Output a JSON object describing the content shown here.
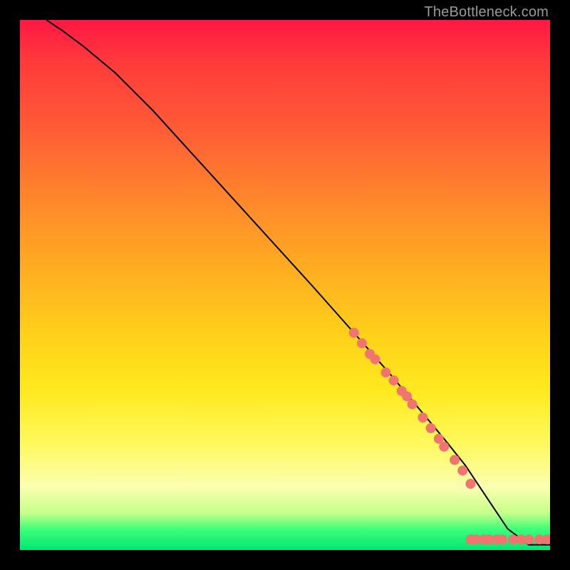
{
  "watermark": "TheBottleneck.com",
  "colors": {
    "dot_fill": "#f07470",
    "curve_stroke": "#000000",
    "background_black": "#000000",
    "gradient_top": "#ff1744",
    "gradient_bottom": "#00e676"
  },
  "chart_data": {
    "type": "line",
    "title": "",
    "xlabel": "",
    "ylabel": "",
    "xlim": [
      0,
      100
    ],
    "ylim": [
      0,
      100
    ],
    "curve": {
      "x": [
        5,
        8,
        12,
        18,
        25,
        35,
        45,
        55,
        63,
        70,
        75,
        80,
        84,
        88,
        92,
        96,
        100
      ],
      "y": [
        100,
        98,
        95,
        90,
        83,
        72,
        61,
        50,
        41,
        33,
        27,
        21,
        16,
        10,
        4,
        1,
        1
      ]
    },
    "series": [
      {
        "name": "marker-cluster-diagonal",
        "x": [
          63,
          64.5,
          66,
          67,
          69,
          70.5,
          72,
          73,
          74,
          76,
          77.5,
          79,
          80,
          82,
          83.5,
          85
        ],
        "y": [
          41,
          39,
          37,
          36,
          33.5,
          32,
          30,
          29,
          27.5,
          25,
          23,
          21,
          19.5,
          17,
          15,
          12.5
        ]
      },
      {
        "name": "marker-cluster-bottom",
        "x": [
          85,
          86,
          87.5,
          88.5,
          90,
          91,
          93,
          94.5,
          96,
          98,
          99.5
        ],
        "y": [
          2,
          2,
          2,
          2,
          2,
          2,
          2,
          2,
          2,
          2,
          2
        ]
      }
    ],
    "dot_radius_px": 7
  }
}
